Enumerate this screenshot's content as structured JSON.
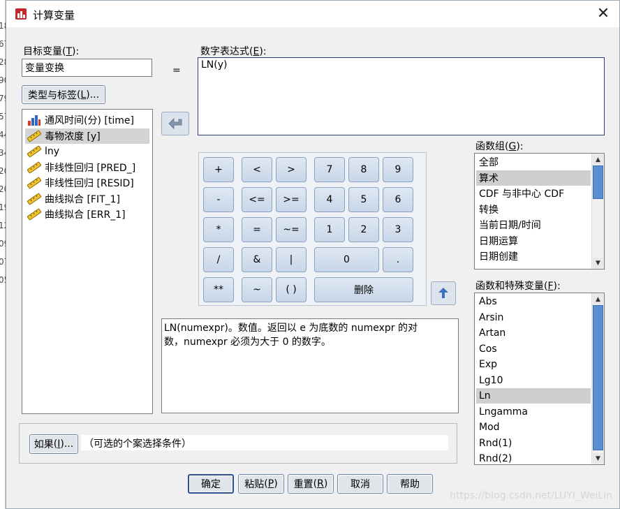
{
  "window": {
    "title": "计算变量",
    "close_glyph": "✕"
  },
  "background_sheet": {
    "row_fragments": [
      "18",
      "67",
      "28",
      "90",
      "79",
      "57",
      "44",
      "34",
      "20",
      "20",
      "19",
      "12",
      "09",
      "07",
      "05"
    ]
  },
  "target": {
    "label": "目标变量",
    "shortcut": "T",
    "value": "变量变换"
  },
  "equals": "=",
  "type_label_button": {
    "label": "类型与标签",
    "shortcut": "L"
  },
  "variables": [
    {
      "label": "通风时间(分) [time]",
      "icon": "scale-icon",
      "selected": false
    },
    {
      "label": "毒物浓度 [y]",
      "icon": "ruler-icon",
      "selected": true
    },
    {
      "label": "lny",
      "icon": "ruler-icon",
      "selected": false
    },
    {
      "label": "非线性回归 [PRED_]",
      "icon": "ruler-icon",
      "selected": false
    },
    {
      "label": "非线性回归 [RESID]",
      "icon": "ruler-icon",
      "selected": false
    },
    {
      "label": "曲线拟合 [FIT_1]",
      "icon": "ruler-icon",
      "selected": false
    },
    {
      "label": "曲线拟合 [ERR_1]",
      "icon": "ruler-icon",
      "selected": false
    }
  ],
  "expression": {
    "label": "数字表达式",
    "shortcut": "E",
    "value": "LN(y)"
  },
  "keypad": {
    "keys": [
      "+",
      "<",
      ">",
      "7",
      "8",
      "9",
      "-",
      "<=",
      ">=",
      "4",
      "5",
      "6",
      "*",
      "=",
      "~=",
      "1",
      "2",
      "3",
      "/",
      "&",
      "|",
      "0",
      ".",
      "**",
      "~",
      "( )",
      "删除"
    ]
  },
  "function_group": {
    "label": "函数组",
    "shortcut": "G",
    "items": [
      "全部",
      "算术",
      "CDF 与非中心 CDF",
      "转换",
      "当前日期/时间",
      "日期运算",
      "日期创建"
    ],
    "selected": "算术"
  },
  "functions": {
    "label": "函数和特殊变量",
    "shortcut": "F",
    "items": [
      "Abs",
      "Arsin",
      "Artan",
      "Cos",
      "Exp",
      "Lg10",
      "Ln",
      "Lngamma",
      "Mod",
      "Rnd(1)",
      "Rnd(2)"
    ],
    "selected": "Ln"
  },
  "description": {
    "line1": "LN(numexpr)。数值。返回以 e 为底数的 numexpr 的对",
    "line2": "数，numexpr 必须为大于 0 的数字。"
  },
  "condition": {
    "if_button": "如果(I)...",
    "if_label_main": "如果",
    "if_shortcut": "I",
    "text": "（可选的个案选择条件）"
  },
  "footer": {
    "ok": "确定",
    "paste": "粘贴",
    "paste_shortcut": "P",
    "reset": "重置",
    "reset_shortcut": "R",
    "cancel": "取消",
    "help": "帮助"
  },
  "watermark": "https://blog.csdn.net/LUYI_WeiLin",
  "colors": {
    "accent": "#5a8fd4",
    "selection": "#d4d4d4"
  }
}
